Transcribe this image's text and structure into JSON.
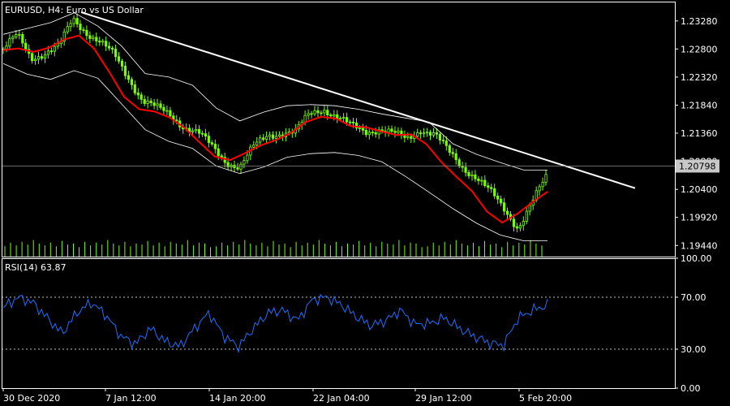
{
  "main_chart": {
    "symbol": "EURUSD",
    "timeframe": "H4",
    "description": "Euro vs US Dollar",
    "current_price": "1.20798",
    "price_ticks": [
      "1.23280",
      "1.22800",
      "1.22320",
      "1.21840",
      "1.21360",
      "1.20880",
      "1.20400",
      "1.19920",
      "1.19440"
    ]
  },
  "rsi": {
    "label": "RSI(14) 63.87",
    "ticks": [
      "100.00",
      "70.00",
      "30.00",
      "0.00"
    ]
  },
  "time_axis": {
    "labels": [
      "30 Dec 2020",
      "7 Jan 12:00",
      "14 Jan 20:00",
      "22 Jan 04:00",
      "29 Jan 12:00",
      "5 Feb 20:00"
    ]
  },
  "colors": {
    "background": "#000000",
    "axis": "#ffffff",
    "bull_candle": "#7CFC00",
    "bear_candle": "#7CFC00",
    "moving_average": "#ff0000",
    "bollinger_bands": "#ffffff",
    "trendline": "#ffffff",
    "rsi_line": "#1e6fff",
    "volume": "#7CFC00",
    "level_dots": "#ffffff"
  },
  "chart_data": [
    {
      "type": "candlestick",
      "title": "EURUSD, H4: Euro vs US Dollar",
      "ylim": [
        1.1925,
        1.2361
      ],
      "x_tick_labels": [
        "30 Dec 2020",
        "7 Jan 12:00",
        "14 Jan 20:00",
        "22 Jan 04:00",
        "29 Jan 12:00",
        "5 Feb 20:00"
      ],
      "y_tick_labels": [
        "1.23280",
        "1.22800",
        "1.22320",
        "1.21840",
        "1.21360",
        "1.20880",
        "1.20400",
        "1.19920",
        "1.19440"
      ],
      "price_close_path": [
        1.228,
        1.2303,
        1.2265,
        1.2274,
        1.2284,
        1.2331,
        1.2309,
        1.2291,
        1.2268,
        1.2231,
        1.2193,
        1.2179,
        1.2167,
        1.2148,
        1.2137,
        1.2112,
        1.2088,
        1.2078,
        1.2112,
        1.2133,
        1.2137,
        1.2137,
        1.2169,
        1.2179,
        1.2163,
        1.2148,
        1.214,
        1.2143,
        1.2135,
        1.2126,
        1.2143,
        1.2134,
        1.2104,
        1.2079,
        1.2061,
        1.2035,
        1.2006,
        1.1975,
        1.2017,
        1.2059
      ],
      "moving_average_path": [
        1.2278,
        1.2281,
        1.2275,
        1.2282,
        1.2296,
        1.2303,
        1.2281,
        1.2241,
        1.2198,
        1.2177,
        1.2173,
        1.2163,
        1.2145,
        1.212,
        1.2096,
        1.209,
        1.2102,
        1.2115,
        1.2124,
        1.2136,
        1.2155,
        1.2164,
        1.2161,
        1.2148,
        1.2146,
        1.2139,
        1.2133,
        1.2134,
        1.2117,
        1.2086,
        1.2061,
        1.2037,
        1.2002,
        1.1983,
        1.1998,
        1.2018,
        1.2036
      ],
      "upper_band_path": [
        1.2305,
        1.2315,
        1.2325,
        1.2342,
        1.2319,
        1.2285,
        1.2238,
        1.2232,
        1.2218,
        1.2179,
        1.2157,
        1.2172,
        1.2183,
        1.2185,
        1.2183,
        1.2177,
        1.2169,
        1.2162,
        1.2155,
        1.2118,
        1.21,
        1.2086,
        1.2073,
        1.2073
      ],
      "lower_band_path": [
        1.2255,
        1.2237,
        1.2228,
        1.2243,
        1.223,
        1.2186,
        1.2142,
        1.2122,
        1.211,
        1.208,
        1.2067,
        1.2078,
        1.2095,
        1.2101,
        1.2103,
        1.2098,
        1.2087,
        1.2062,
        1.2035,
        1.2007,
        1.1982,
        1.1962,
        1.1952,
        1.1952
      ],
      "trendline": {
        "from": 1.2343,
        "to": 1.2042
      },
      "volume_relative": [
        0.35,
        0.55,
        0.4,
        0.6,
        0.45,
        0.7,
        0.5,
        0.4,
        0.55,
        0.35,
        0.65,
        0.45,
        0.5,
        0.3,
        0.6,
        0.4,
        0.55,
        0.45,
        0.7,
        0.5,
        0.4,
        0.6,
        0.35,
        0.5,
        0.45,
        0.65,
        0.4,
        0.55,
        0.35,
        0.6,
        0.5,
        0.45,
        0.7,
        0.4,
        0.55,
        0.5,
        0.3
      ]
    },
    {
      "type": "line",
      "title": "RSI(14) 63.87",
      "ylim": [
        0,
        100
      ],
      "y_tick_labels": [
        "100.00",
        "70.00",
        "30.00",
        "0.00"
      ],
      "levels": [
        70,
        30
      ],
      "series": [
        {
          "name": "RSI(14)",
          "values": [
            62,
            70,
            66,
            54,
            42,
            58,
            66,
            56,
            40,
            34,
            46,
            36,
            32,
            46,
            58,
            40,
            32,
            46,
            58,
            60,
            52,
            68,
            70,
            64,
            55,
            48,
            52,
            60,
            49,
            50,
            54,
            46,
            40,
            35,
            33,
            54,
            60,
            64
          ]
        }
      ]
    }
  ]
}
